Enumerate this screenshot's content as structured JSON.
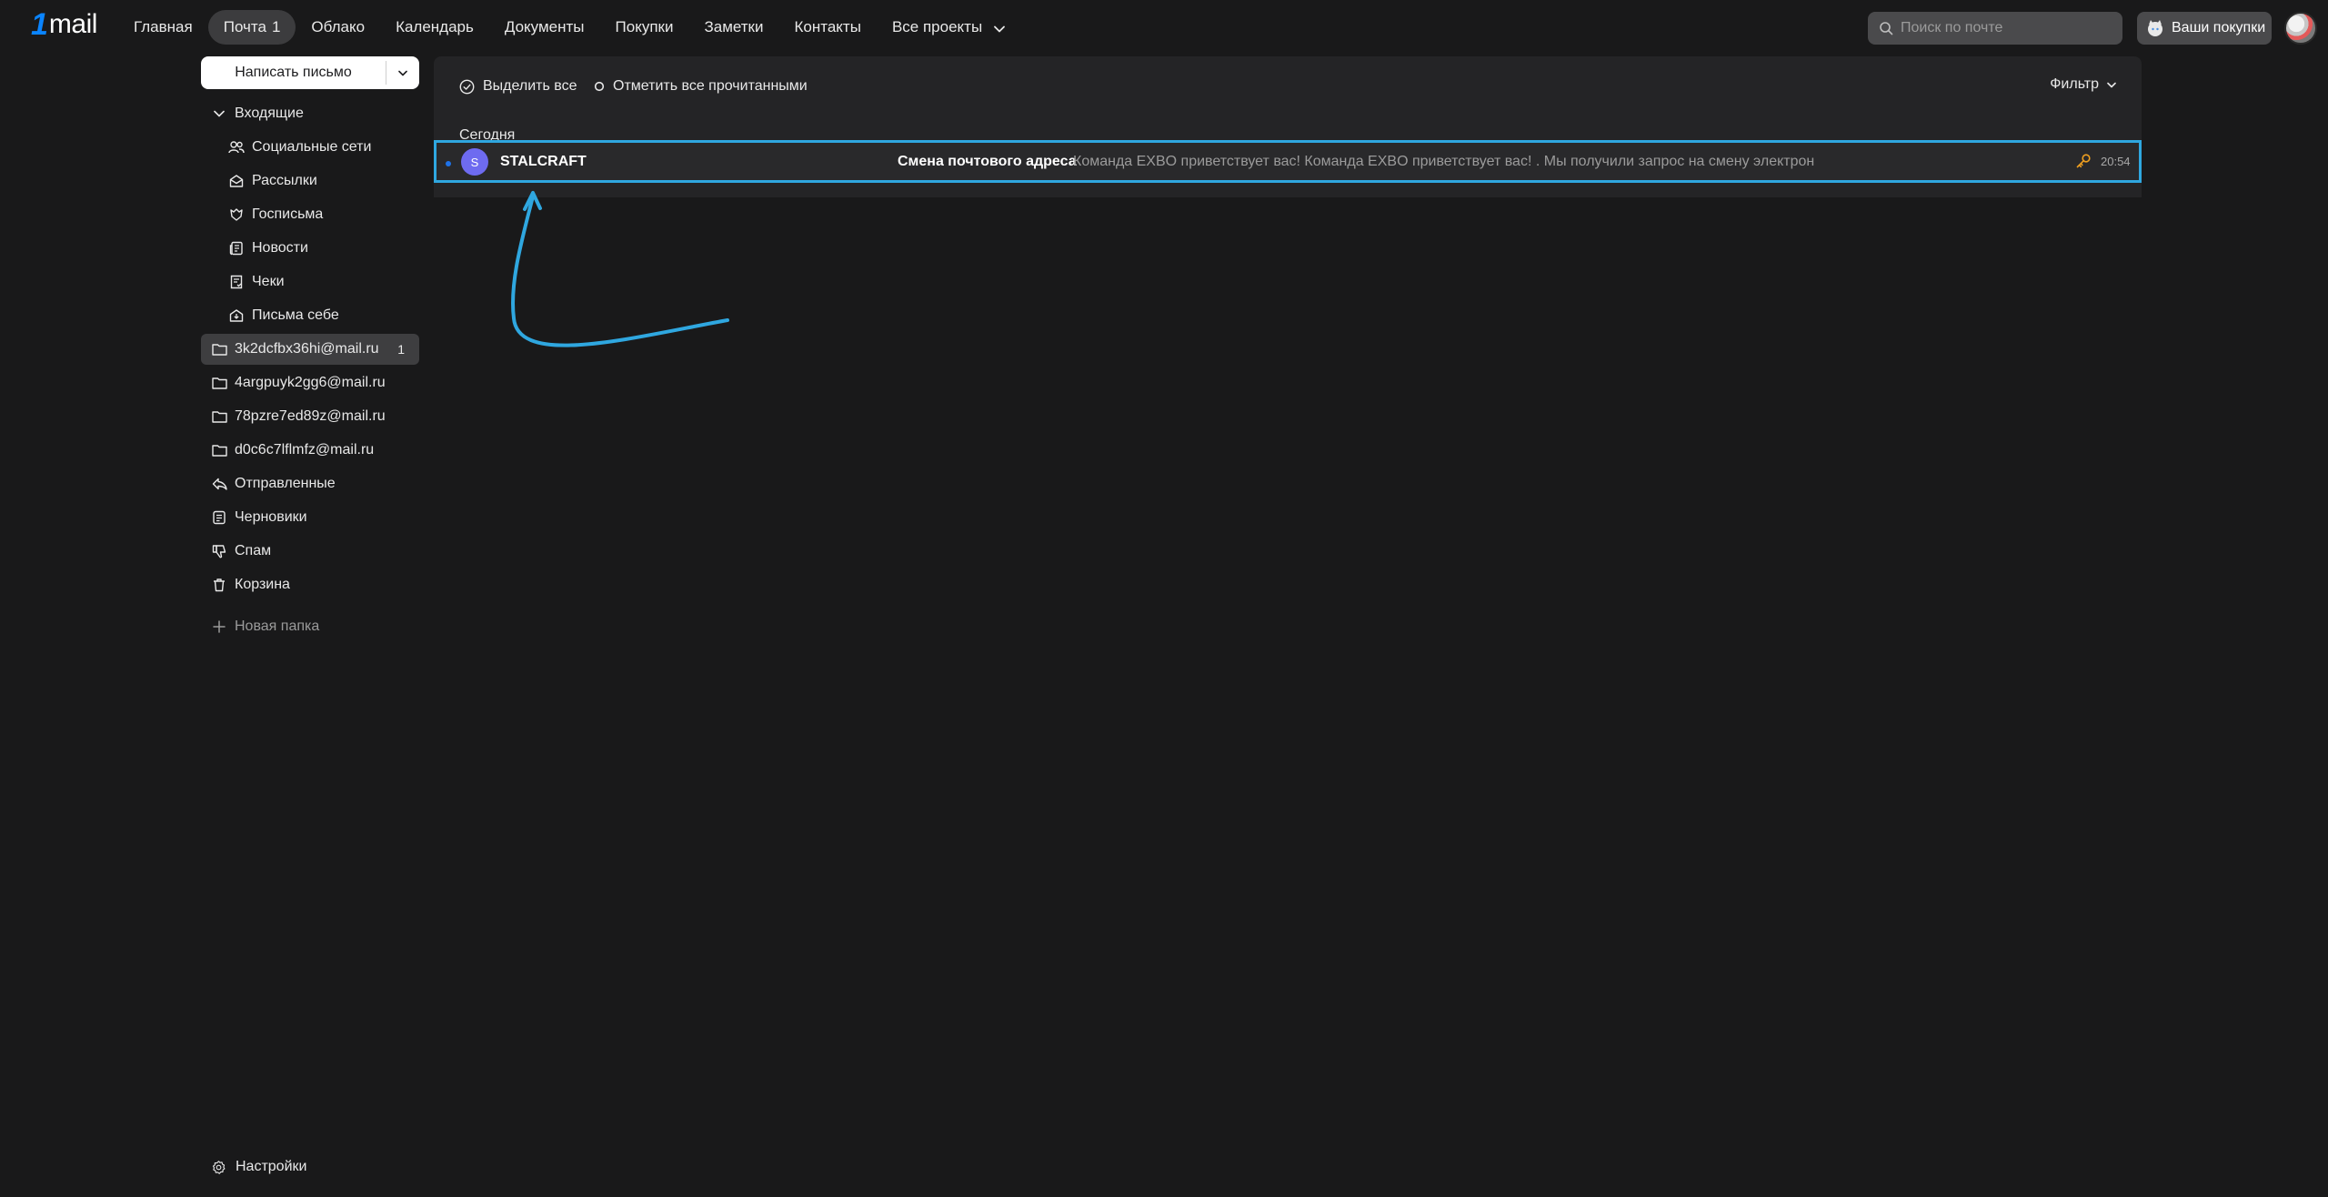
{
  "header": {
    "nav": [
      {
        "label": "Главная"
      },
      {
        "label": "Почта",
        "count": "1",
        "active": true
      },
      {
        "label": "Облако"
      },
      {
        "label": "Календарь"
      },
      {
        "label": "Документы"
      },
      {
        "label": "Покупки"
      },
      {
        "label": "Заметки"
      },
      {
        "label": "Контакты"
      },
      {
        "label": "Все проекты"
      }
    ],
    "search_placeholder": "Поиск по почте",
    "purchases_button": "Ваши покупки"
  },
  "sidebar": {
    "compose_label": "Написать письмо",
    "inbox": "Входящие",
    "categories": [
      {
        "label": "Социальные сети",
        "icon": "people-icon"
      },
      {
        "label": "Рассылки",
        "icon": "envelope-open-icon"
      },
      {
        "label": "Госписьма",
        "icon": "emblem-icon"
      },
      {
        "label": "Новости",
        "icon": "newspaper-icon"
      },
      {
        "label": "Чеки",
        "icon": "receipt-icon"
      },
      {
        "label": "Письма себе",
        "icon": "self-mail-icon"
      }
    ],
    "folders": [
      {
        "label": "3k2dcfbx36hi@mail.ru",
        "badge": "1",
        "selected": true
      },
      {
        "label": "4argpuyk2gg6@mail.ru"
      },
      {
        "label": "78pzre7ed89z@mail.ru"
      },
      {
        "label": "d0c6c7lflmfz@mail.ru"
      }
    ],
    "system": [
      {
        "label": "Отправленные",
        "icon": "sent-icon"
      },
      {
        "label": "Черновики",
        "icon": "drafts-icon"
      },
      {
        "label": "Спам",
        "icon": "spam-icon"
      },
      {
        "label": "Корзина",
        "icon": "trash-icon"
      }
    ],
    "new_folder": "Новая папка",
    "settings": "Настройки"
  },
  "toolbar": {
    "select_all": "Выделить все",
    "mark_read": "Отметить все прочитанными",
    "filter": "Фильтр"
  },
  "messages": {
    "group": "Сегодня",
    "items": [
      {
        "avatar_letter": "S",
        "sender": "STALCRAFT",
        "subject": "Смена почтового адреса",
        "snippet": "Команда EXBO приветствует вас! Команда EXBO приветствует вас! . Мы получили запрос на смену электрон",
        "time": "20:54"
      }
    ]
  },
  "colors": {
    "highlight": "#2fa7e0",
    "avatar": "#6e6bf0",
    "unread_dot": "#1e72e8",
    "key": "#f0a020"
  }
}
